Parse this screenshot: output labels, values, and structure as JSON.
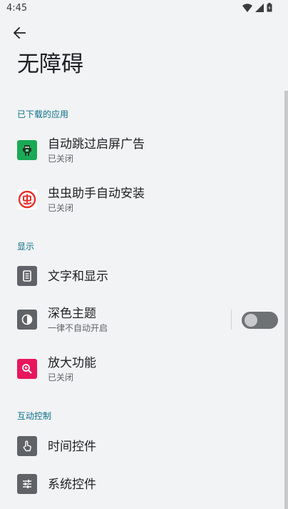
{
  "status_bar": {
    "time": "4:45",
    "icons": [
      "wifi-icon",
      "cellular-signal-icon",
      "battery-icon"
    ]
  },
  "header": {
    "back_icon": "arrow-back-icon",
    "title": "无障碍"
  },
  "sections": [
    {
      "header": "已下载的应用",
      "items": [
        {
          "title": "自动跳过启屏广告",
          "summary": "已关闭",
          "icon": "robot-app-icon",
          "icon_color": "#1aaa55"
        },
        {
          "title": "虫虫助手自动安装",
          "summary": "已关闭",
          "icon": "chongchong-app-icon",
          "icon_color": "#e5322d"
        }
      ]
    },
    {
      "header": "显示",
      "items": [
        {
          "title": "文字和显示",
          "icon": "text-display-icon",
          "icon_color": "#5f6368"
        },
        {
          "title": "深色主题",
          "summary": "一律不自动开启",
          "icon": "dark-theme-icon",
          "icon_color": "#5f6368",
          "toggle": false
        },
        {
          "title": "放大功能",
          "summary": "已关闭",
          "icon": "magnification-icon",
          "icon_color": "#e8175d"
        }
      ]
    },
    {
      "header": "互动控制",
      "items": [
        {
          "title": "时间控件",
          "icon": "touch-timing-icon",
          "icon_color": "#5f6368"
        },
        {
          "title": "系统控件",
          "icon": "system-controls-icon",
          "icon_color": "#5f6368"
        }
      ]
    }
  ],
  "colors": {
    "background": "#f1f3f4",
    "section_header": "#0b6f8a",
    "title_text": "#202124",
    "summary_text": "#5f6368"
  }
}
